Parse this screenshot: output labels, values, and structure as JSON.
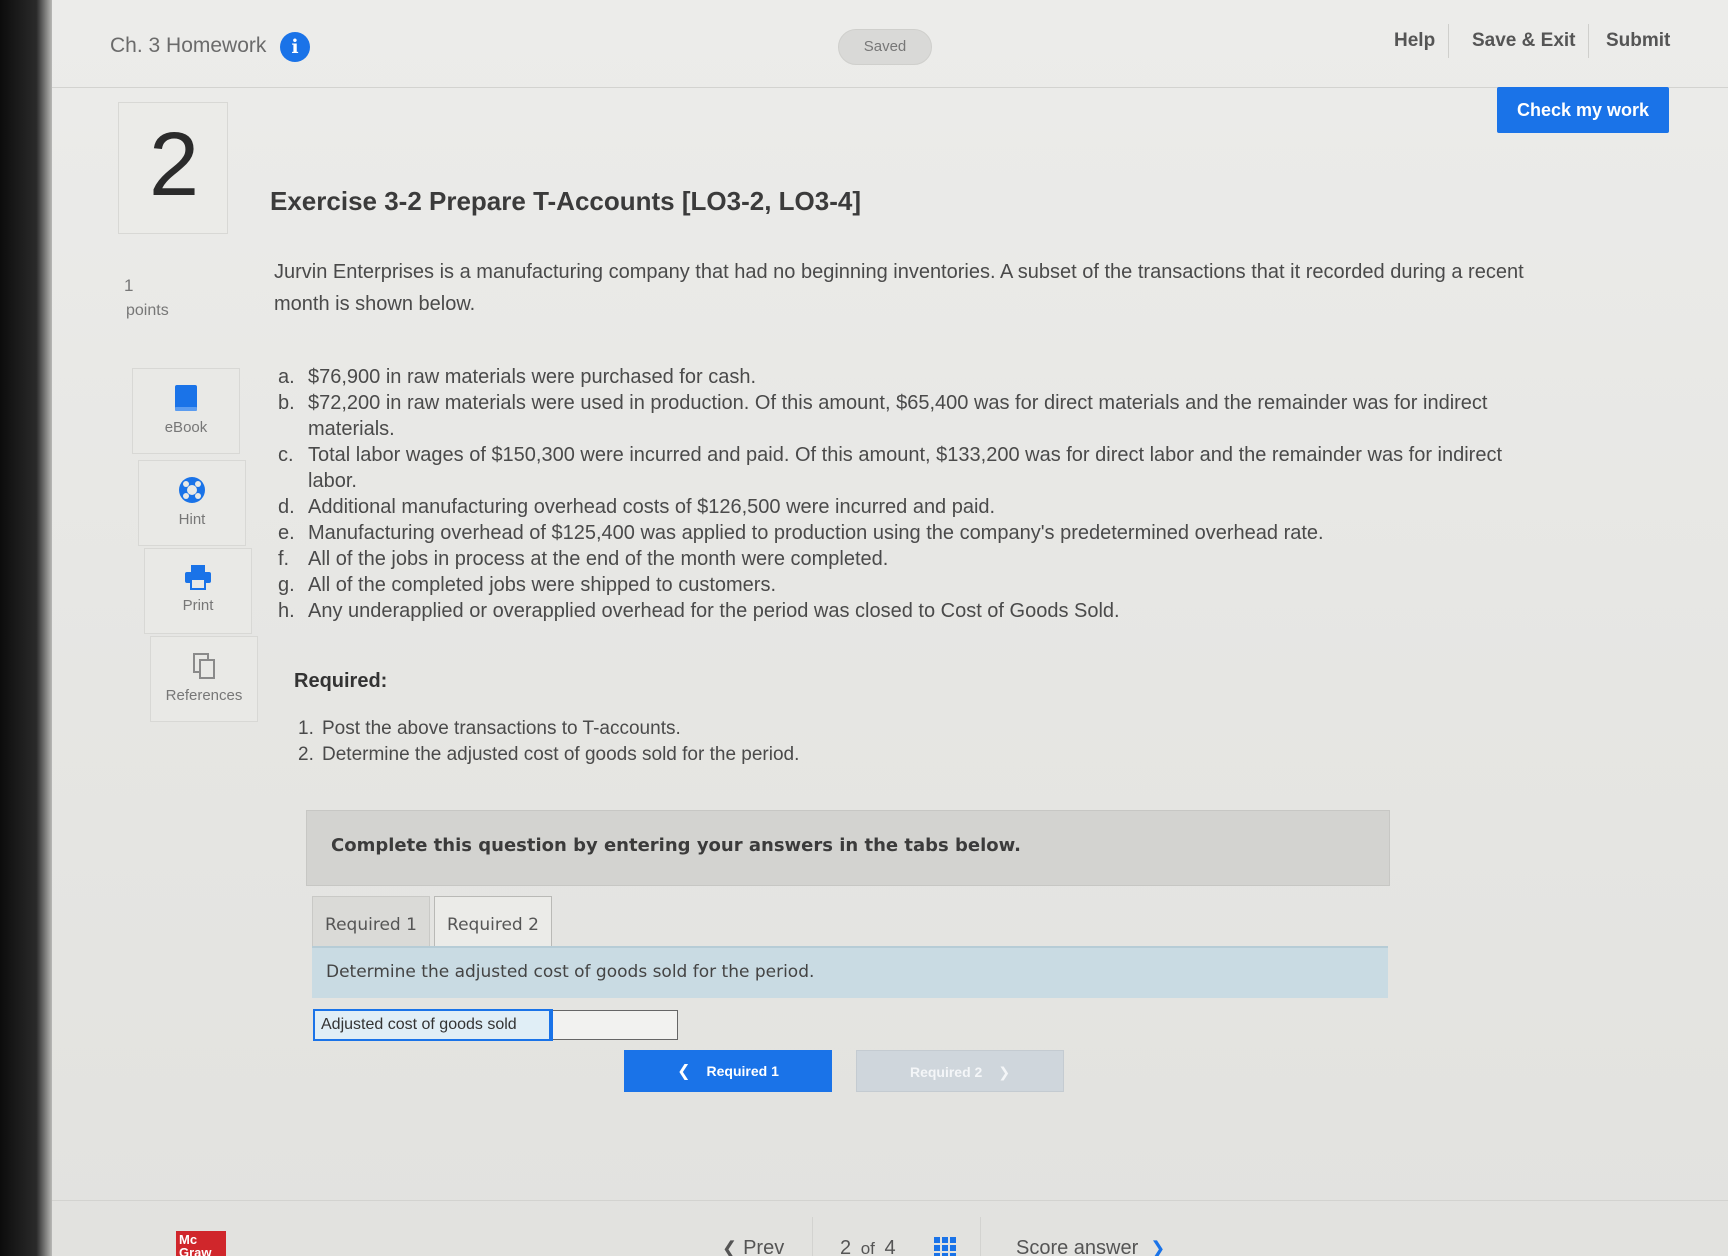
{
  "header": {
    "assignment_title": "Ch. 3 Homework",
    "saved_status": "Saved",
    "help_label": "Help",
    "save_exit_label": "Save & Exit",
    "submit_label": "Submit",
    "check_work_label": "Check my work"
  },
  "question": {
    "number": "2",
    "points_value": "1",
    "points_label": "points",
    "title": "Exercise 3-2 Prepare T-Accounts [LO3-2, LO3-4]",
    "intro": "Jurvin Enterprises is a manufacturing company that had no beginning inventories. A subset of the transactions that it recorded during a recent month is shown below.",
    "transactions": [
      {
        "letter": "a.",
        "text": "$76,900 in raw materials were purchased for cash."
      },
      {
        "letter": "b.",
        "text": "$72,200 in raw materials were used in production. Of this amount, $65,400 was for direct materials and the remainder was for indirect materials."
      },
      {
        "letter": "c.",
        "text": "Total labor wages of $150,300 were incurred and paid. Of this amount, $133,200 was for direct labor and the remainder was for indirect labor."
      },
      {
        "letter": "d.",
        "text": "Additional manufacturing overhead costs of $126,500 were incurred and paid."
      },
      {
        "letter": "e.",
        "text": "Manufacturing overhead of $125,400 was applied to production using the company's predetermined overhead rate."
      },
      {
        "letter": "f.",
        "text": "All of the jobs in process at the end of the month were completed."
      },
      {
        "letter": "g.",
        "text": "All of the completed jobs were shipped to customers."
      },
      {
        "letter": "h.",
        "text": "Any underapplied or overapplied overhead for the period was closed to Cost of Goods Sold."
      }
    ],
    "required_heading": "Required:",
    "required_items": [
      {
        "num": "1.",
        "text": "Post the above transactions to T-accounts."
      },
      {
        "num": "2.",
        "text": "Determine the adjusted cost of goods sold for the period."
      }
    ]
  },
  "tools": {
    "ebook": "eBook",
    "hint": "Hint",
    "print": "Print",
    "references": "References"
  },
  "answer_panel": {
    "instructions": "Complete this question by entering your answers in the tabs below.",
    "tabs": [
      "Required 1",
      "Required 2"
    ],
    "active_tab": "Required 2",
    "prompt": "Determine the adjusted cost of goods sold for the period.",
    "row_label": "Adjusted cost of goods sold",
    "row_value": "",
    "prev_label": "Required 1",
    "next_label": "Required 2"
  },
  "footer": {
    "logo_line1": "Mc",
    "logo_line2": "Graw",
    "prev_label": "Prev",
    "current_page": "2",
    "of_label": "of",
    "total_pages": "4",
    "score_label": "Score answer"
  },
  "colors": {
    "accent": "#1a73e8",
    "logo_red": "#d0262b"
  }
}
